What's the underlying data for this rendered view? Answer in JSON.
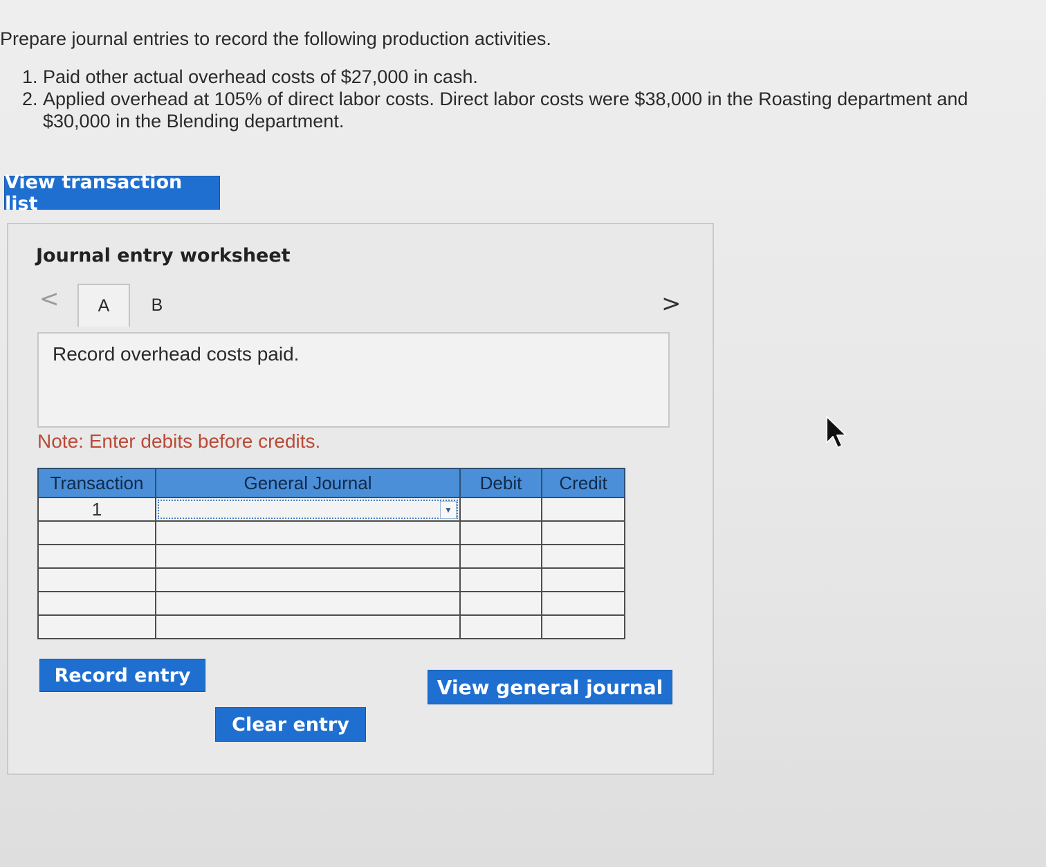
{
  "instructions": {
    "intro": "Prepare journal entries to record the following production activities.",
    "items": [
      "Paid other actual overhead costs of $27,000 in cash.",
      "Applied overhead at 105% of direct labor costs. Direct labor costs were $38,000 in the Roasting department and $30,000 in the Blending department."
    ]
  },
  "buttons": {
    "view_transaction_list": "View transaction list",
    "record_entry": "Record entry",
    "clear_entry": "Clear entry",
    "view_general_journal": "View general journal"
  },
  "worksheet": {
    "title": "Journal entry worksheet",
    "nav_prev": "<",
    "nav_next": ">",
    "tabs": [
      "A",
      "B"
    ],
    "active_tab": "A",
    "description": "Record overhead costs paid.",
    "note": "Note: Enter debits before credits."
  },
  "journal_table": {
    "headers": {
      "transaction": "Transaction",
      "general_journal": "General Journal",
      "debit": "Debit",
      "credit": "Credit"
    },
    "rows": [
      {
        "transaction": "1",
        "account": "",
        "debit": "",
        "credit": ""
      },
      {
        "transaction": "",
        "account": "",
        "debit": "",
        "credit": ""
      },
      {
        "transaction": "",
        "account": "",
        "debit": "",
        "credit": ""
      },
      {
        "transaction": "",
        "account": "",
        "debit": "",
        "credit": ""
      },
      {
        "transaction": "",
        "account": "",
        "debit": "",
        "credit": ""
      },
      {
        "transaction": "",
        "account": "",
        "debit": "",
        "credit": ""
      }
    ]
  },
  "colors": {
    "button_blue": "#1f6fd1",
    "header_blue": "#4a8fd8",
    "note_red": "#b94a37"
  },
  "icons": {
    "dropdown": "chevron-down-icon",
    "pointer": "mouse-cursor-icon"
  }
}
